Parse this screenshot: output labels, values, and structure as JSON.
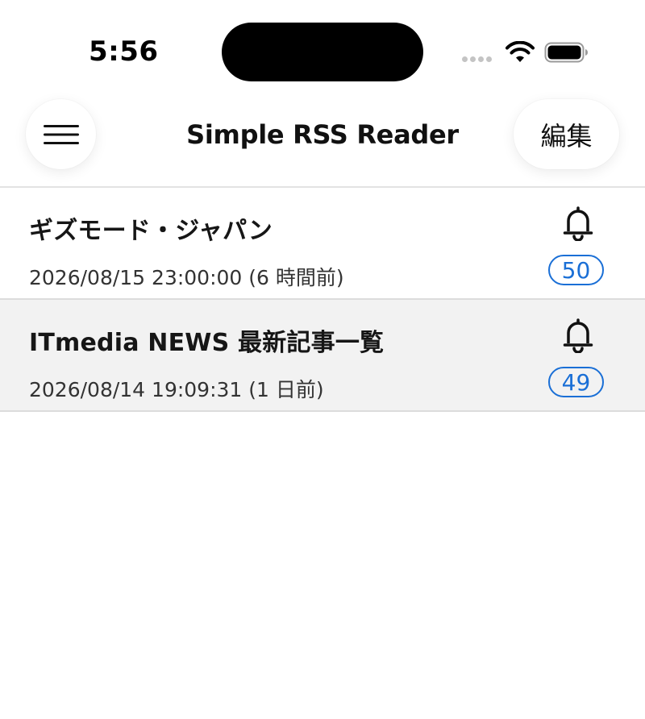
{
  "status_bar": {
    "time": "5:56",
    "icons": [
      "signal-dots-icon",
      "wifi-icon",
      "battery-icon"
    ]
  },
  "nav": {
    "menu_icon": "hamburger-menu-icon",
    "title": "Simple RSS Reader",
    "edit_label": "編集"
  },
  "feeds": [
    {
      "title": "ギズモード・ジャパン",
      "date": "2026/08/15 23:00:00 (6 時間前)",
      "count": "50",
      "icon": "bell-icon",
      "selected": false
    },
    {
      "title": "ITmedia NEWS 最新記事一覧",
      "date": "2026/08/14 19:09:31 (1 日前)",
      "count": "49",
      "icon": "bell-icon",
      "selected": true
    }
  ],
  "colors": {
    "accent": "#1a6fd6",
    "selected_row": "#f2f2f2",
    "divider": "#dcdcdc"
  }
}
